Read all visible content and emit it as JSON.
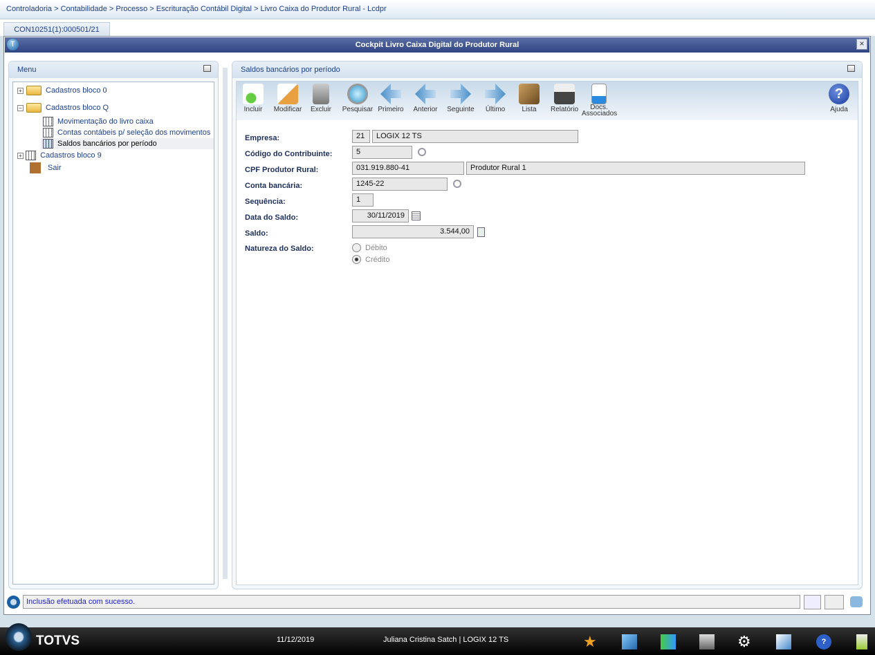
{
  "breadcrumb": "Controladoria > Contabilidade > Processo > Escrituração Contábil Digital > Livro Caixa do Produtor Rural - Lcdpr",
  "tab": "CON10251(1):000501/21",
  "window_title": "Cockpit Livro Caixa Digital do Produtor Rural",
  "menu": {
    "title": "Menu",
    "items": [
      "Cadastros bloco 0",
      "Cadastros bloco Q",
      "Movimentação do livro caixa",
      "Contas contábeis p/ seleção dos movimentos",
      "Saldos bancários por período",
      "Cadastros bloco 9",
      "Sair"
    ]
  },
  "panel_title": "Saldos bancários por período",
  "toolbar": [
    "Incluir",
    "Modificar",
    "Excluir",
    "Pesquisar",
    "Primeiro",
    "Anterior",
    "Seguinte",
    "Último",
    "Lista",
    "Relatório",
    "Docs.",
    "Associados",
    "Ajuda"
  ],
  "form": {
    "empresa_label": "Empresa:",
    "empresa_code": "21",
    "empresa_name": "LOGIX 12 TS",
    "contrib_label": "Código do Contribuinte:",
    "contrib": "5",
    "cpf_label": "CPF Produtor Rural:",
    "cpf": "031.919.880-41",
    "produtor": "Produtor Rural 1",
    "conta_label": "Conta bancária:",
    "conta": "1245-22",
    "seq_label": "Sequência:",
    "seq": "1",
    "data_label": "Data do Saldo:",
    "data": "30/11/2019",
    "saldo_label": "Saldo:",
    "saldo": "3.544,00",
    "natureza_label": "Natureza do Saldo:",
    "debito": "Débito",
    "credito": "Crédito"
  },
  "status": "Inclusão efetuada com sucesso.",
  "taskbar": {
    "brand": "TOTVS",
    "date": "11/12/2019",
    "user": "Juliana Cristina Satch | LOGIX 12 TS"
  }
}
